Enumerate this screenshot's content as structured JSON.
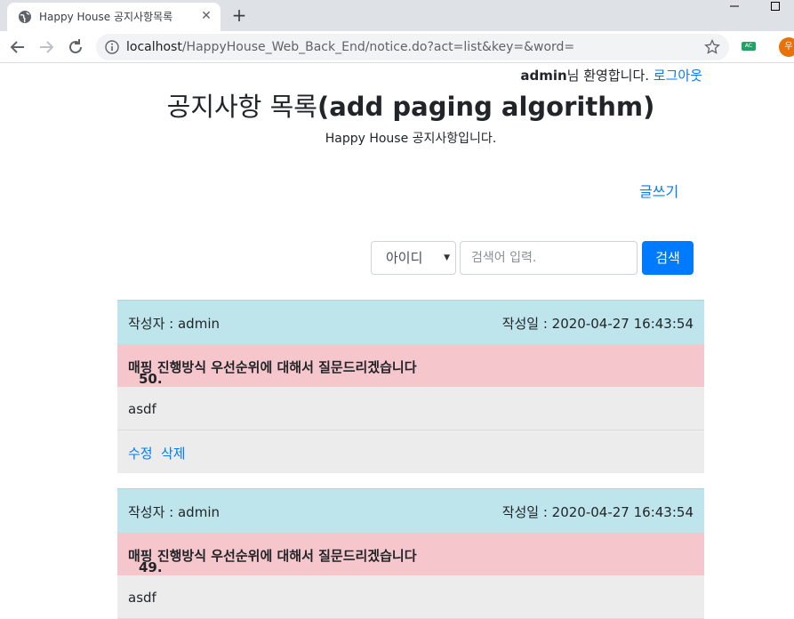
{
  "browser": {
    "tab_title": "Happy House 공지사항목록",
    "url_host": "localhost",
    "url_path": "/HappyHouse_Web_Back_End/notice.do?act=list&key=&word=",
    "extension_label": "AC",
    "profile_initial": "우"
  },
  "header": {
    "user_name": "admin",
    "welcome_suffix": "님 환영합니다.",
    "logout_label": "로그아웃",
    "title_ko": "공지사항 목록",
    "title_en": "(add paging algorithm)",
    "subtitle": "Happy House 공지사항입니다.",
    "write_label": "글쓰기"
  },
  "search": {
    "selected_key": "아이디",
    "placeholder": "검색어 입력.",
    "button_label": "검색"
  },
  "notices": [
    {
      "author": "작성자 : admin",
      "date": "작성일 : 2020-04-27 16:43:54",
      "number": "50.",
      "subject": "매핑 진행방식 우선순위에 대해서 질문드리겠습니다",
      "content": "asdf",
      "edit_label": "수정",
      "delete_label": "삭제"
    },
    {
      "author": "작성자 : admin",
      "date": "작성일 : 2020-04-27 16:43:54",
      "number": "49.",
      "subject": "매핑 진행방식 우선순위에 대해서 질문드리겠습니다",
      "content": "asdf"
    }
  ],
  "colors": {
    "link": "#007bff",
    "header_bg": "#bee5eb",
    "subject_bg": "#f5c6cb",
    "body_bg": "#ececec"
  }
}
